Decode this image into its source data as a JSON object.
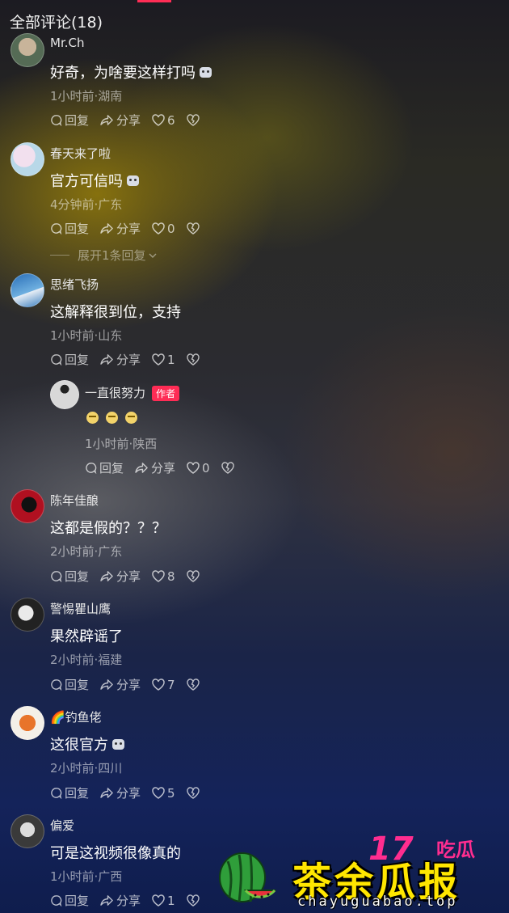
{
  "header": {
    "title": "全部评论(18)"
  },
  "actions_labels": {
    "reply": "回复",
    "share": "分享"
  },
  "comments": [
    {
      "user": "Mr.Ch",
      "text": "好奇，为啥要这样打吗",
      "has_emoji": true,
      "meta": "1小时前·湖南",
      "likes": "6"
    },
    {
      "user": "春天来了啦",
      "text": "官方可信吗",
      "has_emoji": true,
      "meta": "4分钟前·广东",
      "likes": "0",
      "expand": "展开1条回复"
    },
    {
      "user": "思绪飞扬",
      "text": "这解释很到位，支持",
      "meta": "1小时前·山东",
      "likes": "1",
      "reply": {
        "user": "一直很努力",
        "tag": "作者",
        "meta": "1小时前·陕西",
        "likes": "0"
      }
    },
    {
      "user": "陈年佳酿",
      "text": "这都是假的？？？",
      "meta": "2小时前·广东",
      "likes": "8"
    },
    {
      "user": "警惕瞿山鹰",
      "text": "果然辟谣了",
      "meta": "2小时前·福建",
      "likes": "7"
    },
    {
      "user": "🌈钓鱼佬",
      "text": "这很官方",
      "has_emoji": true,
      "meta": "2小时前·四川",
      "likes": "5"
    },
    {
      "user": "偏爱",
      "text": "可是这视频很像真的",
      "meta": "1小时前·广西",
      "likes": "1"
    }
  ],
  "watermark": {
    "top": "17吃瓜",
    "main": "茶余瓜报",
    "url": "chayuguabao.top"
  },
  "colors": {
    "accent": "#fe2c55",
    "watermark_yellow": "#ffe600",
    "watermark_pink": "#ff2d8f"
  }
}
